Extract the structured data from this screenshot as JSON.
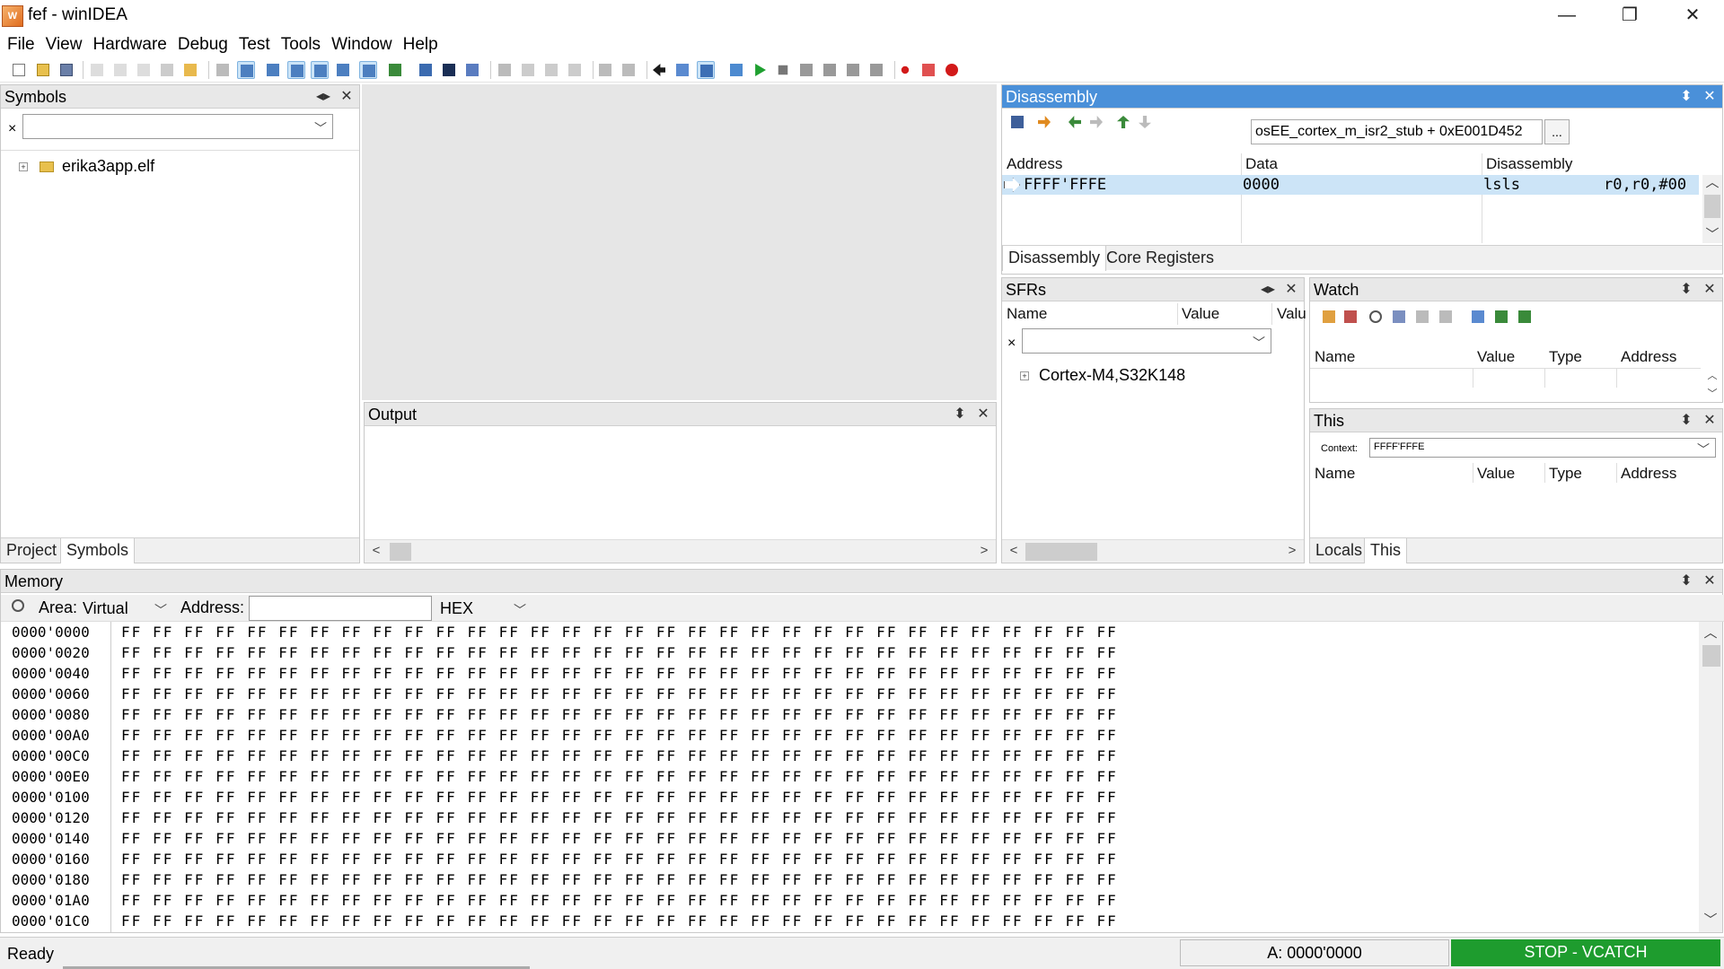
{
  "window": {
    "title": "fef - winIDEA",
    "icon_letter": "W",
    "minimize": "—",
    "maximize": "❐",
    "close": "✕"
  },
  "menu": [
    "File",
    "View",
    "Hardware",
    "Debug",
    "Test",
    "Tools",
    "Window",
    "Help"
  ],
  "symbols": {
    "title": "Symbols",
    "filter_clear": "×",
    "filter_value": "",
    "tree": [
      {
        "label": "erika3app.elf",
        "expander": "+"
      }
    ],
    "tabs": [
      "Project",
      "Symbols"
    ],
    "active_tab": "Symbols"
  },
  "output": {
    "title": "Output"
  },
  "disassembly": {
    "title": "Disassembly",
    "location": "osEE_cortex_m_isr2_stub + 0xE001D452",
    "browse_label": "...",
    "columns": [
      "Address",
      "Data",
      "Disassembly"
    ],
    "rows": [
      {
        "address": "FFFF'FFFE",
        "data": "0000",
        "mnemonic": "lsls",
        "operands": "r0,r0,#00"
      }
    ],
    "tabs": [
      "Disassembly",
      "Core Registers"
    ],
    "active_tab": "Disassembly"
  },
  "sfrs": {
    "title": "SFRs",
    "columns": [
      "Name",
      "Value",
      "Valu"
    ],
    "filter_clear": "×",
    "filter_value": "",
    "tree": [
      {
        "label": "Cortex-M4,S32K148",
        "expander": "+"
      }
    ]
  },
  "watch": {
    "title": "Watch",
    "columns": [
      "Name",
      "Value",
      "Type",
      "Address"
    ]
  },
  "this": {
    "title": "This",
    "context_label": "Context:",
    "context_value": "FFFF'FFFE",
    "columns": [
      "Name",
      "Value",
      "Type",
      "Address"
    ],
    "tabs": [
      "Locals",
      "This"
    ],
    "active_tab": "This"
  },
  "memory": {
    "title": "Memory",
    "area_label": "Area:",
    "area_value": "Virtual",
    "address_label": "Address:",
    "address_value": "",
    "format_value": "HEX",
    "rows": [
      {
        "addr": "0000'0000",
        "bytes": "FF FF FF FF FF FF FF FF FF FF FF FF FF FF FF FF FF FF FF FF FF FF FF FF FF FF FF FF FF FF FF FF"
      },
      {
        "addr": "0000'0020",
        "bytes": "FF FF FF FF FF FF FF FF FF FF FF FF FF FF FF FF FF FF FF FF FF FF FF FF FF FF FF FF FF FF FF FF"
      },
      {
        "addr": "0000'0040",
        "bytes": "FF FF FF FF FF FF FF FF FF FF FF FF FF FF FF FF FF FF FF FF FF FF FF FF FF FF FF FF FF FF FF FF"
      },
      {
        "addr": "0000'0060",
        "bytes": "FF FF FF FF FF FF FF FF FF FF FF FF FF FF FF FF FF FF FF FF FF FF FF FF FF FF FF FF FF FF FF FF"
      },
      {
        "addr": "0000'0080",
        "bytes": "FF FF FF FF FF FF FF FF FF FF FF FF FF FF FF FF FF FF FF FF FF FF FF FF FF FF FF FF FF FF FF FF"
      },
      {
        "addr": "0000'00A0",
        "bytes": "FF FF FF FF FF FF FF FF FF FF FF FF FF FF FF FF FF FF FF FF FF FF FF FF FF FF FF FF FF FF FF FF"
      },
      {
        "addr": "0000'00C0",
        "bytes": "FF FF FF FF FF FF FF FF FF FF FF FF FF FF FF FF FF FF FF FF FF FF FF FF FF FF FF FF FF FF FF FF"
      },
      {
        "addr": "0000'00E0",
        "bytes": "FF FF FF FF FF FF FF FF FF FF FF FF FF FF FF FF FF FF FF FF FF FF FF FF FF FF FF FF FF FF FF FF"
      },
      {
        "addr": "0000'0100",
        "bytes": "FF FF FF FF FF FF FF FF FF FF FF FF FF FF FF FF FF FF FF FF FF FF FF FF FF FF FF FF FF FF FF FF"
      },
      {
        "addr": "0000'0120",
        "bytes": "FF FF FF FF FF FF FF FF FF FF FF FF FF FF FF FF FF FF FF FF FF FF FF FF FF FF FF FF FF FF FF FF"
      },
      {
        "addr": "0000'0140",
        "bytes": "FF FF FF FF FF FF FF FF FF FF FF FF FF FF FF FF FF FF FF FF FF FF FF FF FF FF FF FF FF FF FF FF"
      },
      {
        "addr": "0000'0160",
        "bytes": "FF FF FF FF FF FF FF FF FF FF FF FF FF FF FF FF FF FF FF FF FF FF FF FF FF FF FF FF FF FF FF FF"
      },
      {
        "addr": "0000'0180",
        "bytes": "FF FF FF FF FF FF FF FF FF FF FF FF FF FF FF FF FF FF FF FF FF FF FF FF FF FF FF FF FF FF FF FF"
      },
      {
        "addr": "0000'01A0",
        "bytes": "FF FF FF FF FF FF FF FF FF FF FF FF FF FF FF FF FF FF FF FF FF FF FF FF FF FF FF FF FF FF FF FF"
      },
      {
        "addr": "0000'01C0",
        "bytes": "FF FF FF FF FF FF FF FF FF FF FF FF FF FF FF FF FF FF FF FF FF FF FF FF FF FF FF FF FF FF FF FF"
      }
    ]
  },
  "status": {
    "left": "Ready",
    "address": "A: 0000'0000",
    "state": "STOP - VCATCH",
    "state_color": "#1e9c2e"
  },
  "colors": {
    "active_header": "#4a90d9",
    "selected_row": "#cce4f7"
  }
}
